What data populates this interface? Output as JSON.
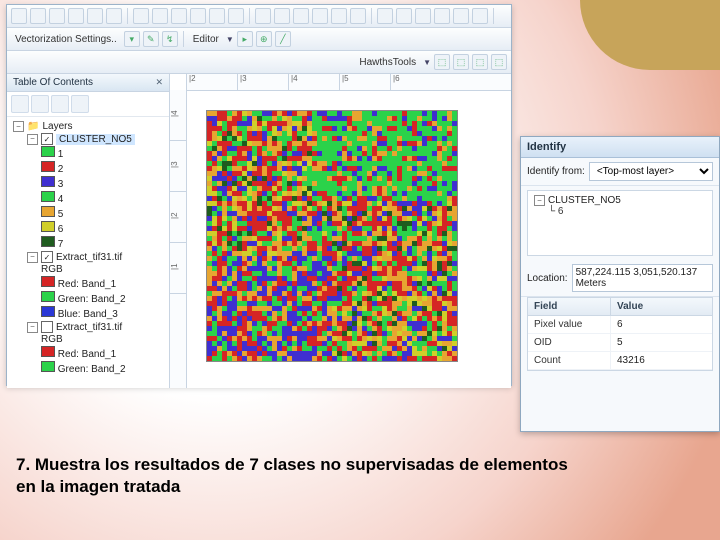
{
  "toolbar1": {
    "icons": 24
  },
  "toolbar2": {
    "label": "Vectorization Settings..",
    "editor": "Editor"
  },
  "toolbar3": {
    "hawths": "HawthsTools"
  },
  "toc": {
    "title": "Table Of Contents",
    "layers_label": "Layers",
    "cluster": {
      "name": "CLUSTER_NO5",
      "classes": [
        {
          "v": "1",
          "c": "#2bd24a"
        },
        {
          "v": "2",
          "c": "#d52525"
        },
        {
          "v": "3",
          "c": "#3f2fd0"
        },
        {
          "v": "4",
          "c": "#2bd24a"
        },
        {
          "v": "5",
          "c": "#e7a531"
        },
        {
          "v": "6",
          "c": "#d0cf2a"
        },
        {
          "v": "7",
          "c": "#1f5c1f"
        }
      ]
    },
    "extract1": {
      "name": "Extract_tif31.tif",
      "sub": "RGB",
      "bands": [
        {
          "c": "#d52525",
          "t": "Red:   Band_1"
        },
        {
          "c": "#2bd24a",
          "t": "Green: Band_2"
        },
        {
          "c": "#2a38d6",
          "t": "Blue:  Band_3"
        }
      ]
    },
    "extract2": {
      "name": "Extract_tif31.tif",
      "sub": "RGB",
      "bands": [
        {
          "c": "#d52525",
          "t": "Red:   Band_1"
        },
        {
          "c": "#2bd24a",
          "t": "Green: Band_2"
        }
      ]
    }
  },
  "ruler_h": [
    "|2",
    "|3",
    "|4",
    "|5",
    "|6"
  ],
  "ruler_v": [
    "|4",
    "|3",
    "|2",
    "|1"
  ],
  "identify": {
    "title": "Identify",
    "from_label": "Identify from:",
    "from_value": "<Top-most layer>",
    "tree_layer": "CLUSTER_NO5",
    "tree_value": "6",
    "location_label": "Location:",
    "location_value": "587,224.115 3,051,520.137 Meters",
    "field_hdr": "Field",
    "value_hdr": "Value",
    "rows": [
      {
        "f": "Pixel value",
        "v": "6"
      },
      {
        "f": "OID",
        "v": "5"
      },
      {
        "f": "Count",
        "v": "43216"
      }
    ]
  },
  "caption": "7. Muestra los resultados de 7 clases no supervisadas de elementos en la imagen tratada"
}
